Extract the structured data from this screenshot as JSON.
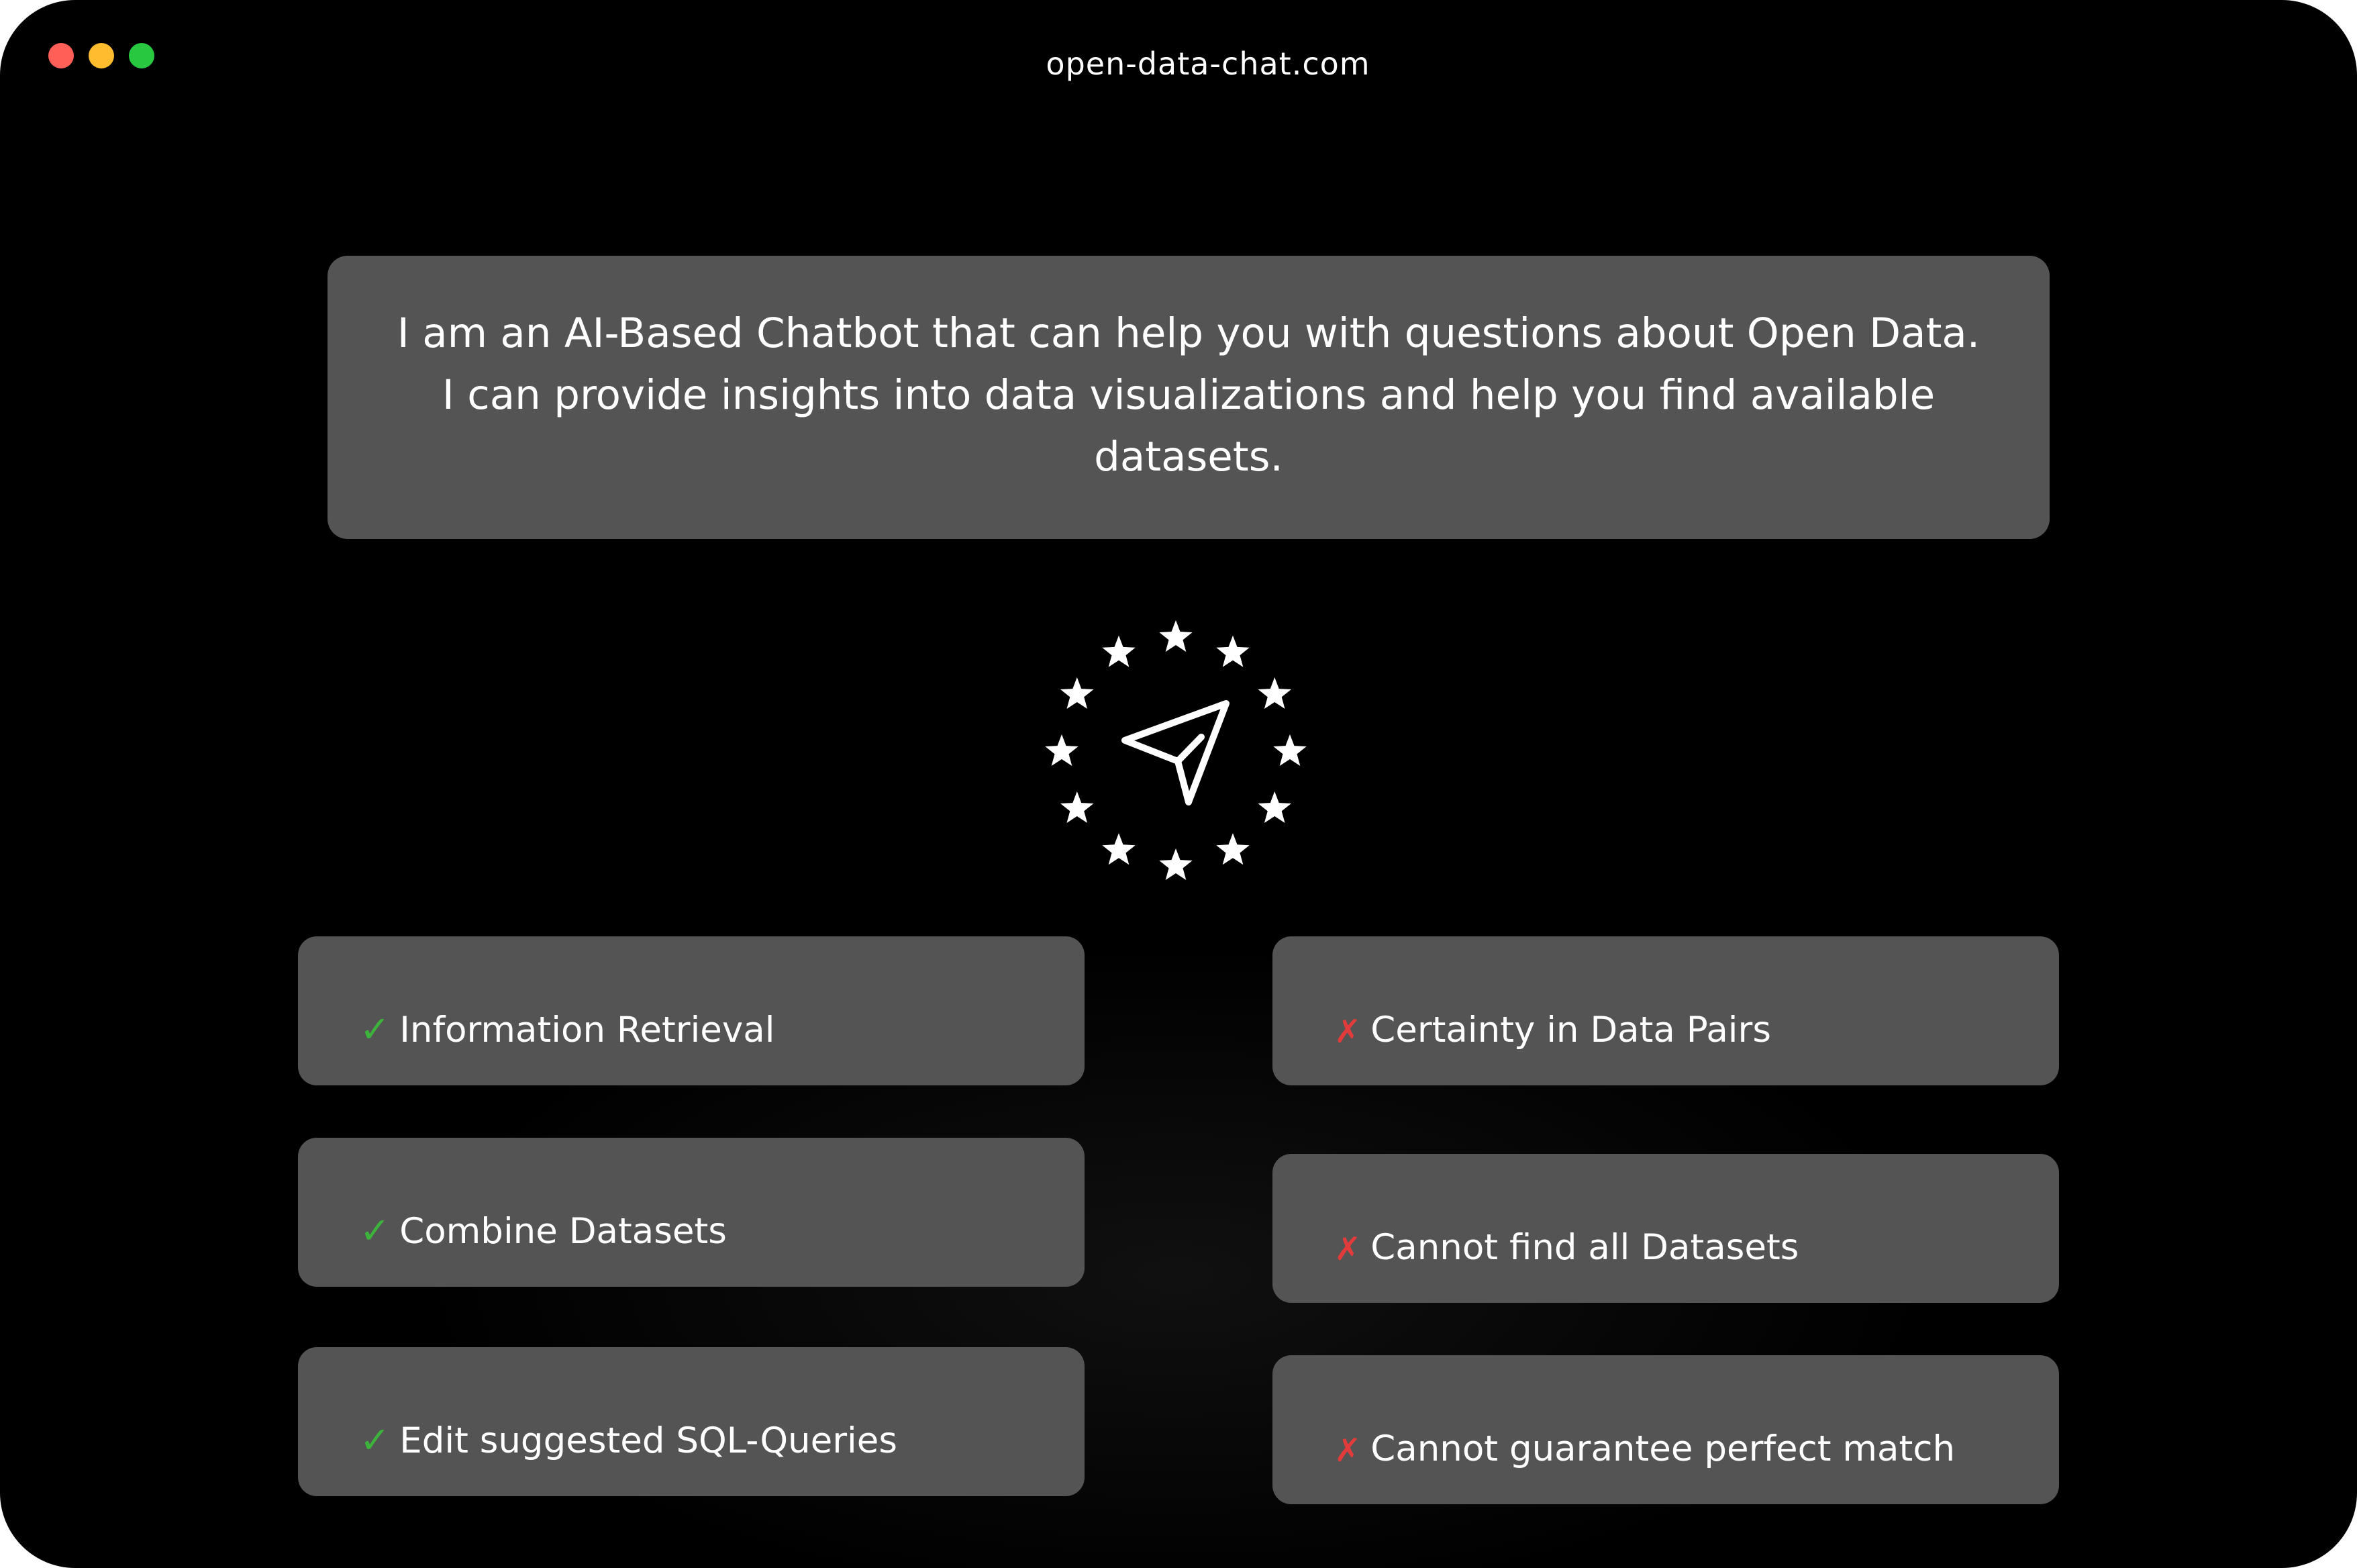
{
  "window": {
    "url": "open-data-chat.com"
  },
  "intro": {
    "text": "I am an AI-Based Chatbot that can help you with questions about Open Data. I can provide insights into data visualizations and help you find available datasets."
  },
  "logo": {
    "icon": "send-icon",
    "stars_icon": "star-icon"
  },
  "capabilities": {
    "items": [
      {
        "mark": "✓",
        "label": "Information Retrieval"
      },
      {
        "mark": "✓",
        "label": "Combine Datasets"
      },
      {
        "mark": "✓",
        "label": "Edit suggested SQL-Queries"
      }
    ]
  },
  "limitations": {
    "items": [
      {
        "mark": "✗",
        "label": "Certainty in Data Pairs"
      },
      {
        "mark": "✗",
        "label": "Cannot find all Datasets"
      },
      {
        "mark": "✗",
        "label": "Cannot guarantee perfect match"
      }
    ]
  },
  "colors": {
    "background": "#000000",
    "card": "#545454",
    "check": "#3cb43c",
    "cross": "#e33b3b",
    "close": "#ff5f57",
    "minimize": "#febc2e",
    "maximize": "#28c840"
  }
}
